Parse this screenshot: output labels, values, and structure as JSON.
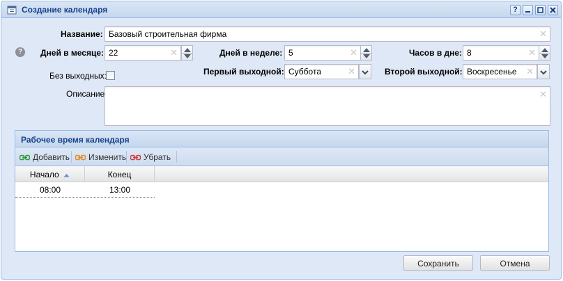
{
  "window": {
    "title": "Создание календаря",
    "icon": "calendar-icon",
    "tools": [
      "help-icon",
      "minimize-icon",
      "maximize-icon",
      "close-icon"
    ]
  },
  "form": {
    "name": {
      "label": "Название:",
      "value": "Базовый строительная фирма"
    },
    "days_in_month": {
      "label": "Дней в месяце:",
      "value": "22"
    },
    "days_in_week": {
      "label": "Дней в неделе:",
      "value": "5"
    },
    "hours_per_day": {
      "label": "Часов в дне:",
      "value": "8"
    },
    "no_days_off": {
      "label": "Без выходных:",
      "checked": false
    },
    "first_day_off": {
      "label": "Первый выходной:",
      "value": "Суббота"
    },
    "second_day_off": {
      "label": "Второй выходной:",
      "value": "Воскресенье"
    },
    "description": {
      "label": "Описание:",
      "value": ""
    }
  },
  "work_time": {
    "title": "Рабочее время календаря",
    "toolbar": {
      "add": "Добавить",
      "edit": "Изменить",
      "remove": "Убрать"
    },
    "columns": [
      {
        "label": "Начало",
        "sorted": "asc"
      },
      {
        "label": "Конец"
      }
    ],
    "rows": [
      {
        "start": "08:00",
        "end": "13:00"
      }
    ]
  },
  "buttons": {
    "save": "Сохранить",
    "cancel": "Отмена"
  },
  "colors": {
    "accent": "#15428b",
    "panel_bg": "#dfe8f6",
    "border": "#99bbe8"
  }
}
